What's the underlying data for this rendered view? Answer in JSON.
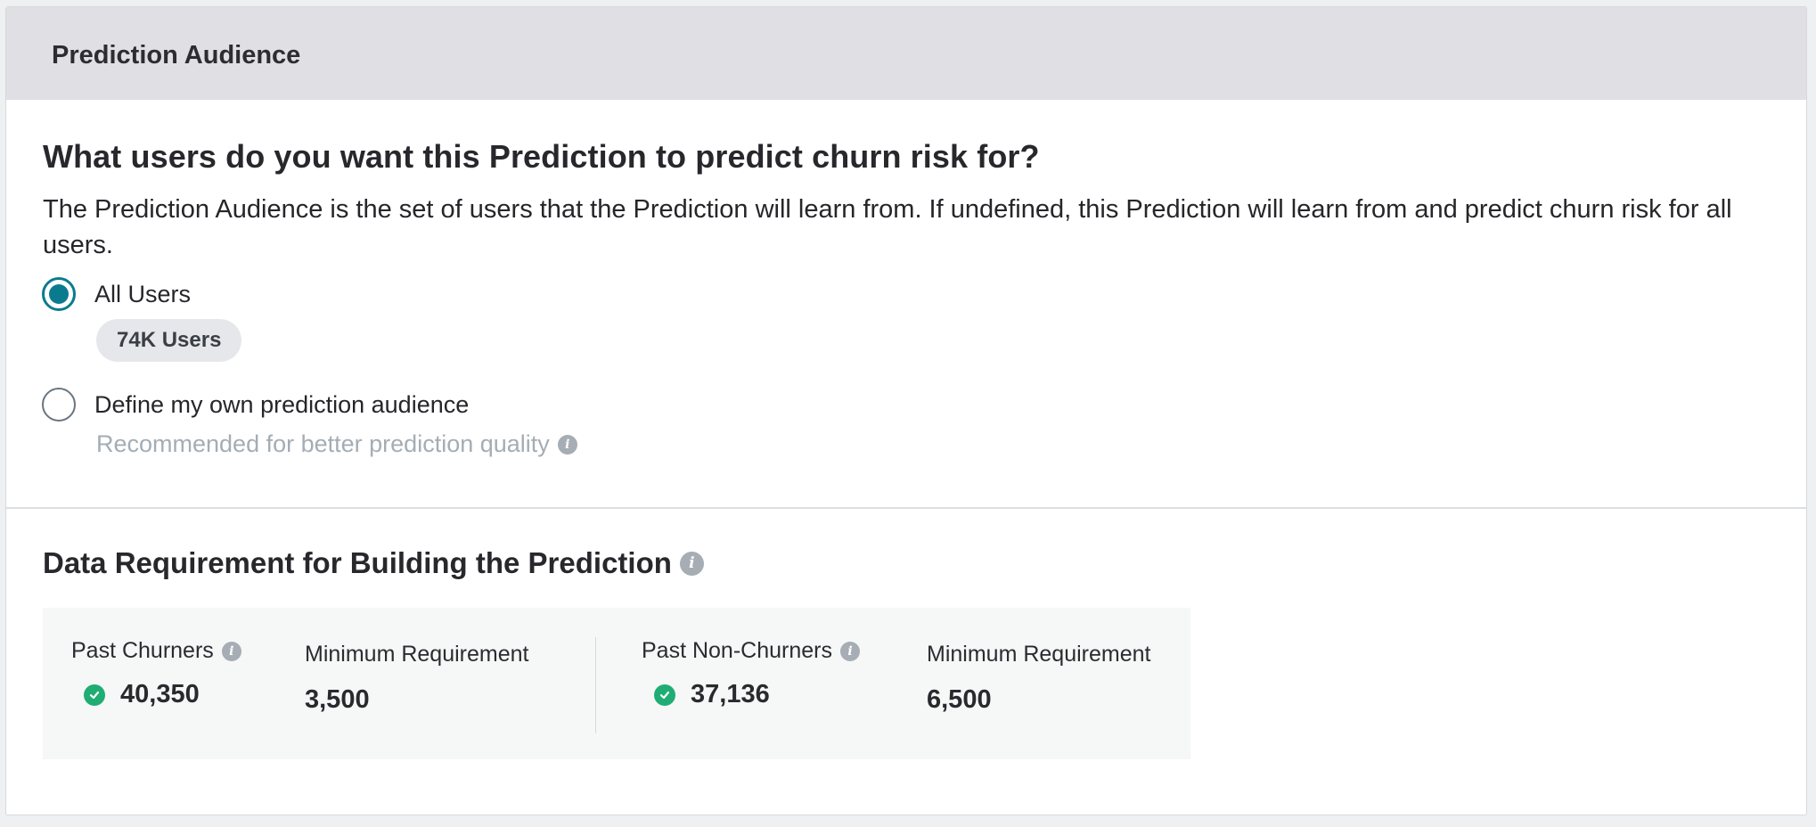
{
  "header": {
    "title": "Prediction Audience"
  },
  "audience": {
    "question": "What users do you want this Prediction to predict churn risk for?",
    "description": "The Prediction Audience is the set of users that the Prediction will learn from. If undefined, this Prediction will learn from and predict churn risk for all users.",
    "options": [
      {
        "label": "All Users",
        "selected": true,
        "badge": "74K Users"
      },
      {
        "label": "Define my own prediction audience",
        "selected": false,
        "hint": "Recommended for better prediction quality"
      }
    ]
  },
  "requirements": {
    "title": "Data Requirement for Building the Prediction",
    "churners": {
      "label": "Past Churners",
      "value": "40,350",
      "min_label": "Minimum Requirement",
      "min_value": "3,500"
    },
    "non_churners": {
      "label": "Past Non-Churners",
      "value": "37,136",
      "min_label": "Minimum Requirement",
      "min_value": "6,500"
    }
  },
  "colors": {
    "accent": "#0a7b8f",
    "success": "#1fad73",
    "header_bg": "#dfdfe4",
    "muted": "#a4adb5"
  },
  "icons": {
    "info": "info-icon",
    "check": "check-circle-icon"
  }
}
